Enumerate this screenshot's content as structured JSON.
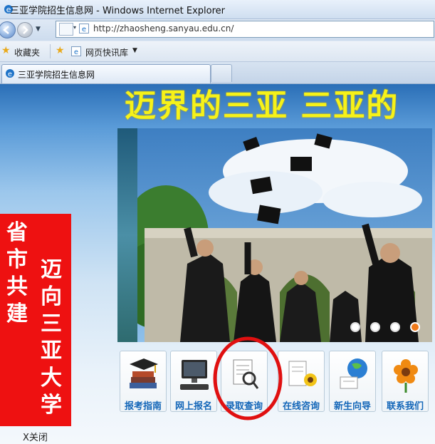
{
  "window": {
    "title": "三亚学院招生信息网 - Windows Internet Explorer"
  },
  "address": {
    "url": "http://zhaosheng.sanyau.edu.cn/"
  },
  "favorites": {
    "label": "收藏夹",
    "quick_gallery": "网页快讯库"
  },
  "tab": {
    "title": "三亚学院招生信息网"
  },
  "page": {
    "banner_text": "迈界的三亚   三亚的",
    "side_banner": {
      "col1": "省市共建",
      "col2": "迈向三亚大学"
    },
    "close_link": "X关闭",
    "slider_dots": 4,
    "slider_active_dot": 3,
    "nav_buttons": [
      {
        "label": "报考指南",
        "icon": "guide-icon"
      },
      {
        "label": "网上报名",
        "icon": "computer-icon"
      },
      {
        "label": "录取查询",
        "icon": "document-search-icon"
      },
      {
        "label": "在线咨询",
        "icon": "notepad-flower-icon"
      },
      {
        "label": "新生向导",
        "icon": "globe-icon"
      },
      {
        "label": "联系我们",
        "icon": "flower-icon"
      }
    ],
    "annotation": {
      "type": "red-circle",
      "target": "录取查询"
    }
  },
  "colors": {
    "accent_red": "#ee1111",
    "link_blue": "#1366b8",
    "banner_yellow": "#f6f219"
  }
}
